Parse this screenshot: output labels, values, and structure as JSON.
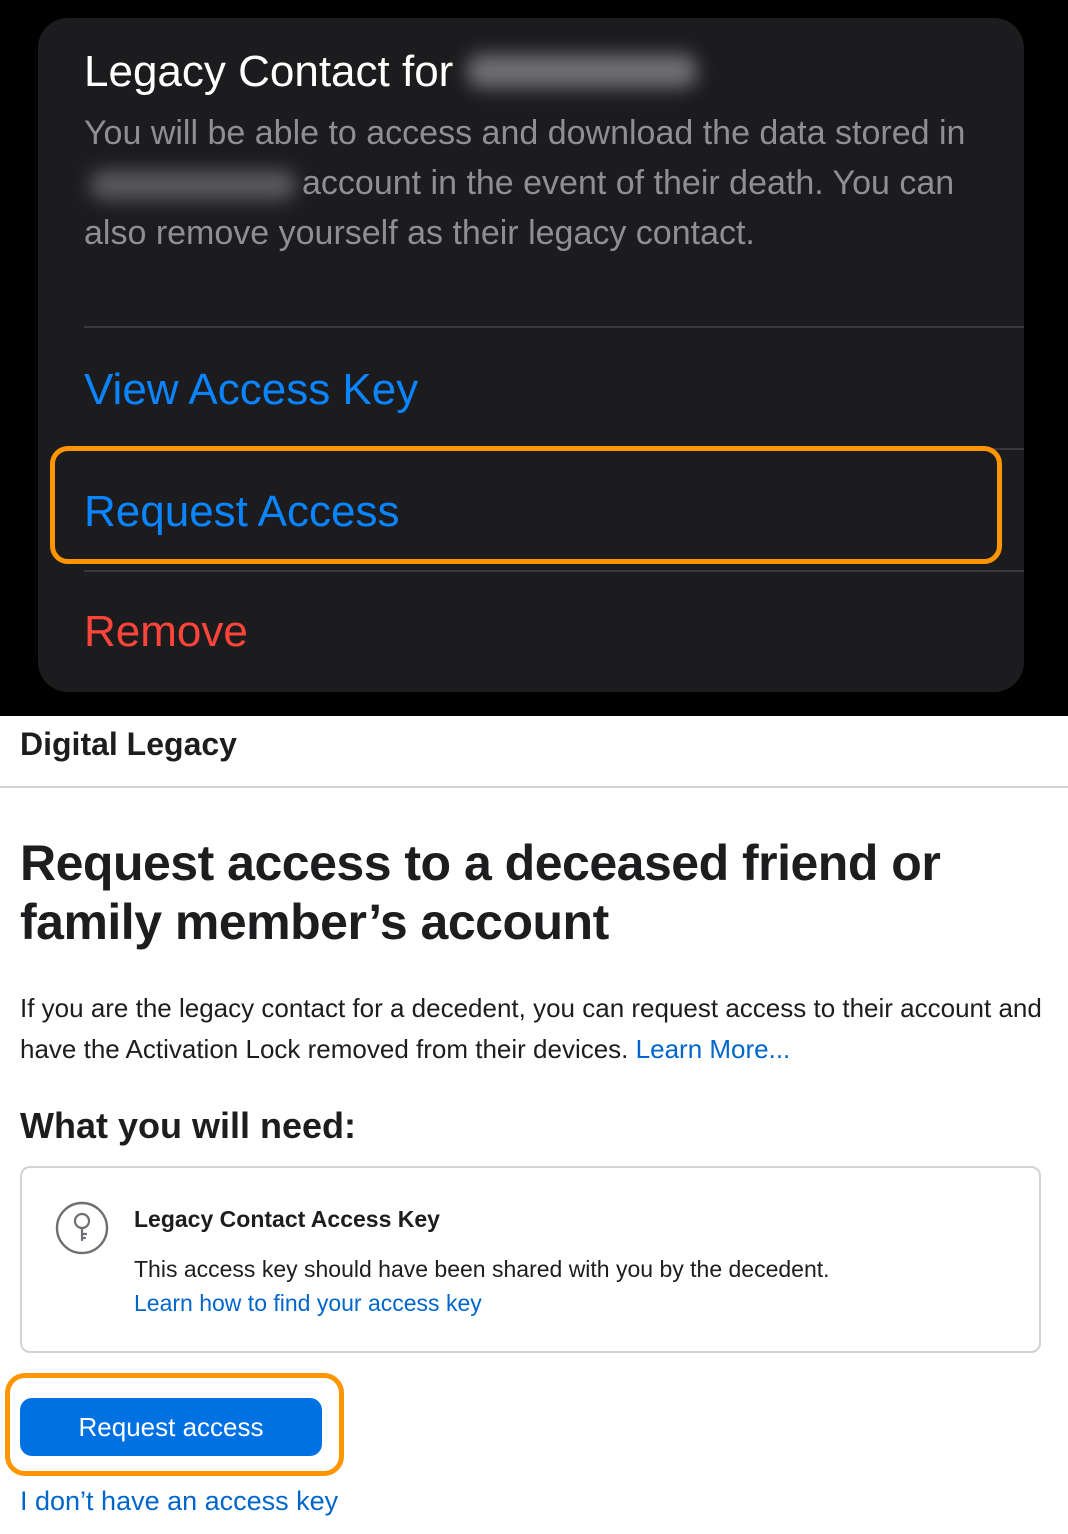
{
  "legacy_card": {
    "title": "Legacy Contact for",
    "description_part1": "You will be able to access and download the data stored in",
    "description_part2": "account in the event of their death. You can also remove yourself as their legacy contact.",
    "actions": {
      "view_access_key": "View Access Key",
      "request_access": "Request Access",
      "remove": "Remove"
    },
    "colors": {
      "action_blue": "#0a84ff",
      "destructive_red": "#ff453a",
      "highlight": "#ff9500"
    }
  },
  "web_page": {
    "nav_title": "Digital Legacy",
    "heading": "Request access to a deceased friend or family member’s account",
    "intro": "If you are the legacy contact for a decedent, you can request access to their account and have the Activation Lock removed from their devices.",
    "learn_more": "Learn More...",
    "need_heading": "What you will need:",
    "requirement": {
      "icon": "key-icon",
      "title": "Legacy Contact Access Key",
      "description": "This access key should have been shared with you by the decedent.",
      "link": "Learn how to find your access key"
    },
    "primary_button": "Request access",
    "alt_link": "I don’t have an access key",
    "colors": {
      "button_blue": "#0071e3",
      "link_blue": "#0066cc"
    }
  }
}
